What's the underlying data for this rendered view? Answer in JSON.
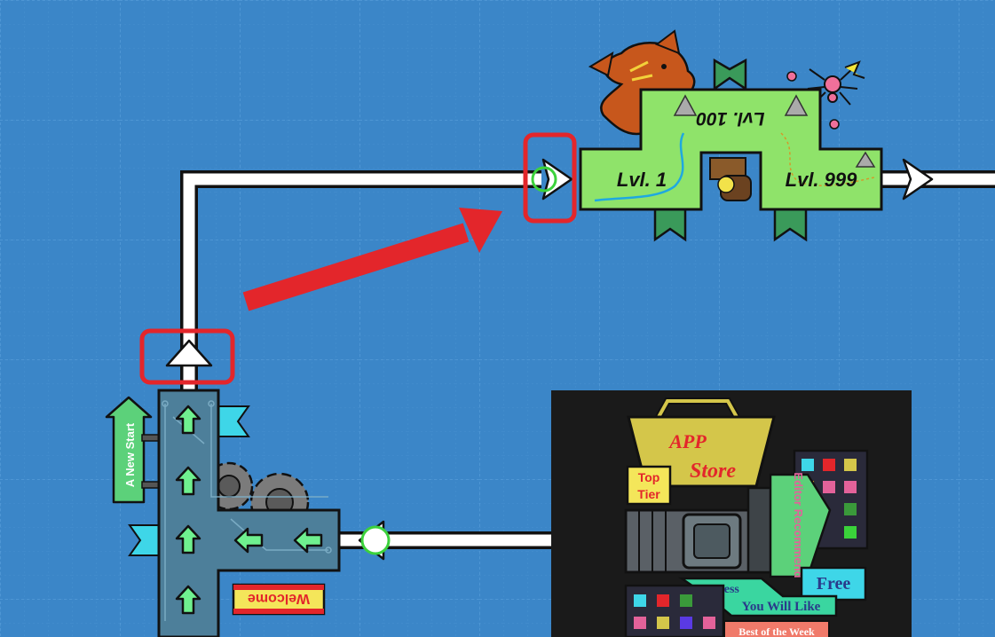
{
  "colors": {
    "background": "#3b86c8",
    "grid": "#4a93d2",
    "path": "#ffffff",
    "highlight": "#e3262b",
    "level_map": "#8fe36a",
    "hub": "#4d7f9a",
    "hub_arrow": "#6ff08f",
    "store_bg": "#1a1a1a",
    "store_bag": "#d4c64a"
  },
  "level_map": {
    "label_left": "Lvl. 1",
    "label_top": "Lvl. 100",
    "label_right": "Lvl. 999"
  },
  "hub": {
    "new_start_label": "A New Start",
    "welcome_label": "Welcome"
  },
  "app_store": {
    "title_line1": "APP",
    "title_line2": "Store",
    "top_tier_line1": "Top",
    "top_tier_line2": "Tier",
    "editor_recommend": "Editor Recommend",
    "free_label": "Free",
    "guess_line1": "Guess",
    "guess_line2": "You Will Like",
    "best_of_week": "Best of the Week"
  },
  "icons": [
    "dragon-icon",
    "spider-icon",
    "treasure-chest-icon",
    "gear-icon",
    "up-arrow-icon",
    "left-arrow-icon",
    "flag-icon",
    "tablet-icon"
  ]
}
